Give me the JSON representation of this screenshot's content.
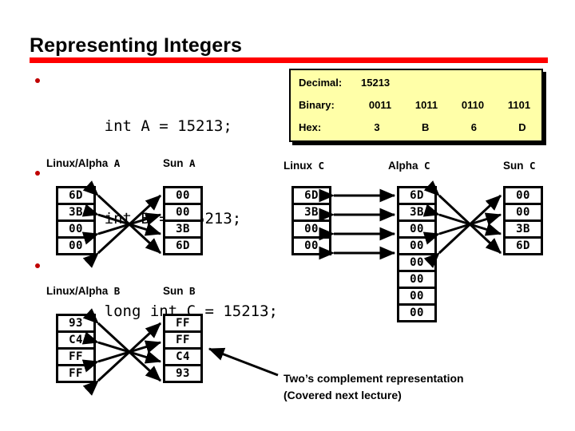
{
  "title": "Representing Integers",
  "accent_color": "#ff0000",
  "code_list": [
    "int A = 15213;",
    "int B = -15213;",
    "long int C = 15213;"
  ],
  "value_box": {
    "background": "#ffffa8",
    "decimal_label": "Decimal:",
    "decimal_value": "15213",
    "binary_label": "Binary:",
    "binary_nibbles": [
      "0011",
      "1011",
      "0110",
      "1101"
    ],
    "hex_label": "Hex:",
    "hex_digits": [
      "3",
      "B",
      "6",
      "D"
    ]
  },
  "groups": [
    {
      "id": "a",
      "tables": [
        {
          "id": "linux-alpha-a",
          "header_name": "Linux/Alpha",
          "header_var": "A",
          "cells": [
            "6D",
            "3B",
            "00",
            "00"
          ]
        },
        {
          "id": "sun-a",
          "header_name": "Sun",
          "header_var": "A",
          "cells": [
            "00",
            "00",
            "3B",
            "6D"
          ]
        }
      ]
    },
    {
      "id": "b",
      "tables": [
        {
          "id": "linux-alpha-b",
          "header_name": "Linux/Alpha",
          "header_var": "B",
          "cells": [
            "93",
            "C4",
            "FF",
            "FF"
          ]
        },
        {
          "id": "sun-b",
          "header_name": "Sun",
          "header_var": "B",
          "cells": [
            "FF",
            "FF",
            "C4",
            "93"
          ]
        }
      ]
    },
    {
      "id": "c",
      "tables": [
        {
          "id": "linux-c",
          "header_name": "Linux",
          "header_var": "C",
          "cells": [
            "6D",
            "3B",
            "00",
            "00"
          ]
        },
        {
          "id": "alpha-c",
          "header_name": "Alpha",
          "header_var": "C",
          "cells": [
            "6D",
            "3B",
            "00",
            "00",
            "00",
            "00",
            "00",
            "00"
          ]
        },
        {
          "id": "sun-c",
          "header_name": "Sun",
          "header_var": "C",
          "cells": [
            "00",
            "00",
            "3B",
            "6D"
          ]
        }
      ]
    }
  ],
  "caption": "Two’s complement representation\n(Covered next lecture)"
}
